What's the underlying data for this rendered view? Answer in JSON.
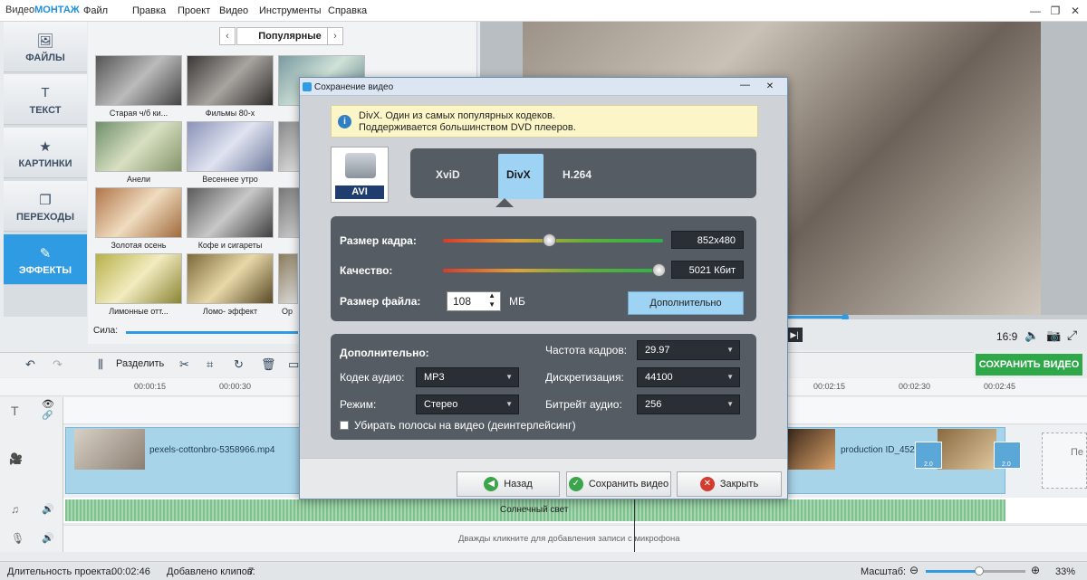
{
  "app": {
    "logo_prefix": "Видео",
    "logo_bold": "МОНТАЖ"
  },
  "menu": [
    "Файл",
    "Правка",
    "Проект",
    "Видео",
    "Инструменты",
    "Справка"
  ],
  "window_controls": {
    "min": "—",
    "max": "❐",
    "close": "✕"
  },
  "sidebar": [
    {
      "label": "ФАЙЛЫ",
      "icon": "image-icon",
      "glyph": "🖼"
    },
    {
      "label": "ТЕКСТ",
      "icon": "text-icon",
      "glyph": "T"
    },
    {
      "label": "КАРТИНКИ",
      "icon": "star-icon",
      "glyph": "★"
    },
    {
      "label": "ПЕРЕХОДЫ",
      "icon": "transitions-icon",
      "glyph": "❐"
    },
    {
      "label": "ЭФФЕКТЫ",
      "icon": "effects-icon",
      "glyph": "✎"
    }
  ],
  "effects": {
    "category": "Популярные",
    "thumbs": [
      "Старая ч/б ки...",
      "Фильмы 80-х",
      "Анели",
      "Весеннее утро",
      "Золотая осень",
      "Кофе и сигареты",
      "Лимонные отт...",
      "Ломо- эффект",
      "Ор"
    ],
    "strength_label": "Сила:"
  },
  "preview": {
    "ratio": "16:9"
  },
  "toolbar": {
    "split": "Разделить",
    "save_video": "СОХРАНИТЬ ВИДЕО"
  },
  "timeline": {
    "ticks": [
      "00:00:15",
      "00:00:30",
      "00:02:15",
      "00:02:30",
      "00:02:45"
    ],
    "clip1": "pexels-cottonbro-5358966.mp4",
    "clip2": "production ID_452",
    "audio": "Солнечный свет",
    "mic_hint": "Дважды кликните для добавления записи с микрофона",
    "trans1": "2.0",
    "trans2": "2.0",
    "cut_text": "Пе"
  },
  "status": {
    "duration_label": "Длительность проекта:",
    "duration": "00:02:46",
    "clips_label": "Добавлено клипов:",
    "clips": "7",
    "zoom_label": "Масштаб:",
    "zoom": "33%",
    "zoom_fraction": 0.53
  },
  "dialog": {
    "title": "Сохранение видео",
    "info_line1": "DivX. Один из самых популярных кодеков.",
    "info_line2": "Поддерживается большинством DVD плееров.",
    "format_badge": "AVI",
    "codecs": [
      "XviD",
      "DivX",
      "H.264"
    ],
    "selected_codec": "DivX",
    "frame_size_label": "Размер кадра:",
    "frame_size": "852x480",
    "quality_label": "Качество:",
    "quality": "5021 Кбит",
    "file_size_label": "Размер файла:",
    "file_size": "108",
    "file_size_unit": "МБ",
    "more_button": "Дополнительно",
    "adv_title": "Дополнительно:",
    "fps_label": "Частота кадров:",
    "fps": "29.97",
    "audio_codec_label": "Кодек аудио:",
    "audio_codec": "MP3",
    "sampling_label": "Дискретизация:",
    "sampling": "44100",
    "mode_label": "Режим:",
    "mode": "Стерео",
    "bitrate_label": "Битрейт аудио:",
    "bitrate": "256",
    "deinterlace_label": "Убирать полосы на видео (деинтерлейсинг)",
    "back_button": "Назад",
    "save_button": "Сохранить видео",
    "close_button": "Закрыть"
  }
}
